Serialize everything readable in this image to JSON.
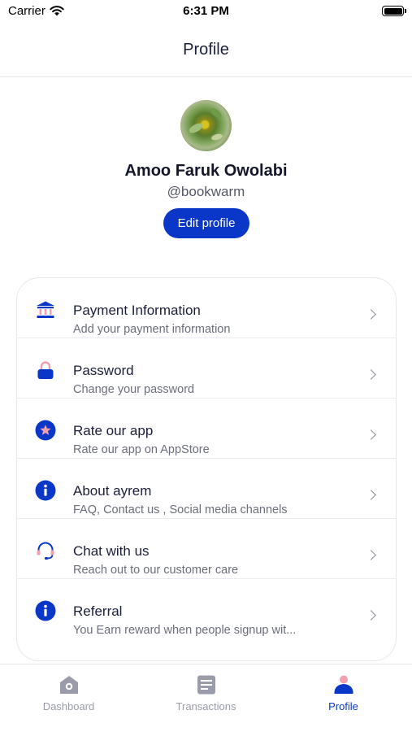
{
  "status_bar": {
    "carrier": "Carrier",
    "time": "6:31 PM",
    "wifi_icon": "wifi-icon",
    "battery_icon": "battery-icon"
  },
  "header": {
    "title": "Profile"
  },
  "profile": {
    "name": "Amoo Faruk Owolabi",
    "handle": "@bookwarm",
    "edit_label": "Edit profile",
    "avatar_icon": "avatar-photo"
  },
  "menu": {
    "items": [
      {
        "title": "Payment Information",
        "subtitle": "Add your payment information",
        "icon": "bank-icon"
      },
      {
        "title": "Password",
        "subtitle": "Change your password",
        "icon": "lock-icon"
      },
      {
        "title": "Rate our app",
        "subtitle": "Rate our app on AppStore",
        "icon": "star-icon"
      },
      {
        "title": "About ayrem",
        "subtitle": "FAQ, Contact us , Social media channels",
        "icon": "info-icon"
      },
      {
        "title": "Chat with us",
        "subtitle": "Reach out to our customer care",
        "icon": "headset-icon"
      },
      {
        "title": "Referral",
        "subtitle": "You Earn reward when people signup wit...",
        "icon": "info-icon"
      }
    ]
  },
  "tab_bar": {
    "tabs": [
      {
        "label": "Dashboard",
        "icon": "home-icon",
        "active": false
      },
      {
        "label": "Transactions",
        "icon": "receipt-icon",
        "active": false
      },
      {
        "label": "Profile",
        "icon": "user-icon",
        "active": true
      }
    ]
  },
  "colors": {
    "accent": "#0a37c8",
    "accent_pink": "#f2a0ae",
    "text_primary": "#1b1f3b",
    "text_secondary": "#6b6e7c",
    "tab_inactive": "#9a9cab"
  }
}
